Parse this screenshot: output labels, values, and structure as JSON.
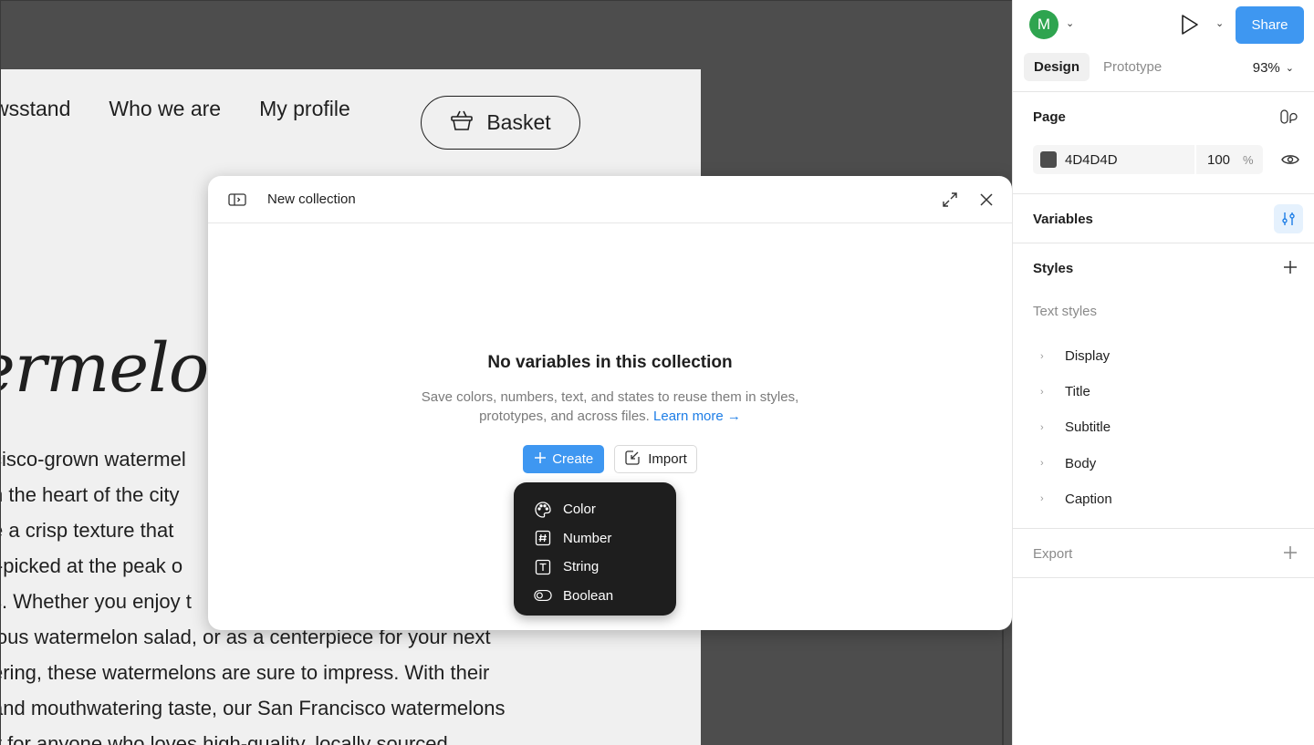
{
  "canvas": {
    "nav": [
      "wsstand",
      "Who we are",
      "My profile"
    ],
    "basket_label": "Basket",
    "hero_title": "ermelon",
    "hero_lines": [
      "cisco-grown watermel",
      "n the heart of the city",
      "e a crisp texture that",
      "l-picked at the peak o",
      "s. Whether you enjoy t",
      "ious watermelon salad, or as a centerpiece for your next",
      "ering, these watermelons are sure to impress. With their",
      "and mouthwatering taste, our San Francisco watermelons",
      "y for anyone who loves high-quality, locally sourced"
    ]
  },
  "modal": {
    "title": "New collection",
    "empty_title": "No variables in this collection",
    "empty_desc": "Save colors, numbers, text, and states to reuse them in styles, prototypes, and across files.",
    "learn_more": "Learn more →",
    "create_label": "Create",
    "import_label": "Import"
  },
  "dropdown": {
    "items": [
      {
        "label": "Color",
        "icon": "palette-icon"
      },
      {
        "label": "Number",
        "icon": "hash-icon"
      },
      {
        "label": "String",
        "icon": "text-icon"
      },
      {
        "label": "Boolean",
        "icon": "toggle-icon"
      }
    ]
  },
  "panel": {
    "avatar_letter": "M",
    "share_label": "Share",
    "tabs": [
      "Design",
      "Prototype"
    ],
    "zoom": "93%",
    "page": {
      "title": "Page",
      "fill_hex": "4D4D4D",
      "opacity": "100",
      "pct": "%"
    },
    "variables_title": "Variables",
    "styles": {
      "title": "Styles",
      "text_styles_label": "Text styles",
      "items": [
        "Display",
        "Title",
        "Subtitle",
        "Body",
        "Caption"
      ]
    },
    "export_label": "Export"
  },
  "colors": {
    "canvas_bg": "#4d4d4d",
    "accent": "#3e97f1",
    "avatar": "#2ea44f",
    "dropdown_bg": "#1e1e1e"
  }
}
